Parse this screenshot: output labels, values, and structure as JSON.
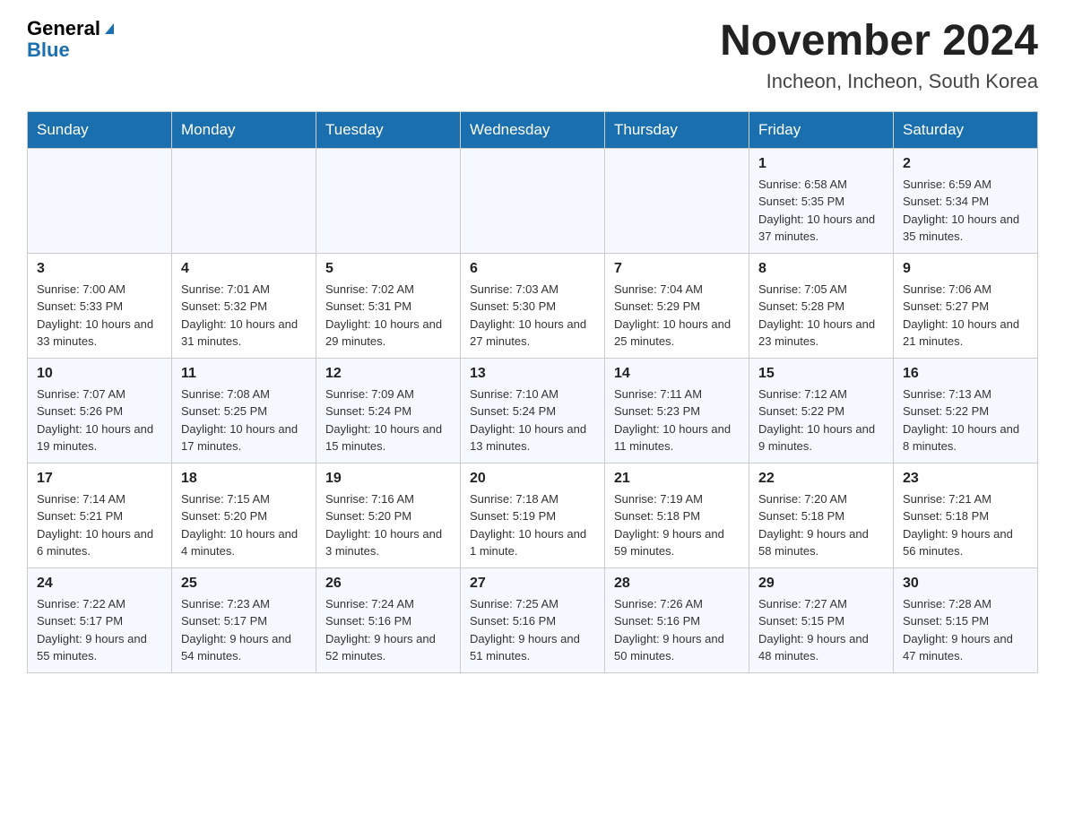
{
  "header": {
    "logo_general": "General",
    "logo_blue": "Blue",
    "title": "November 2024",
    "subtitle": "Incheon, Incheon, South Korea"
  },
  "days_of_week": [
    "Sunday",
    "Monday",
    "Tuesday",
    "Wednesday",
    "Thursday",
    "Friday",
    "Saturday"
  ],
  "weeks": [
    [
      {
        "day": "",
        "info": ""
      },
      {
        "day": "",
        "info": ""
      },
      {
        "day": "",
        "info": ""
      },
      {
        "day": "",
        "info": ""
      },
      {
        "day": "",
        "info": ""
      },
      {
        "day": "1",
        "info": "Sunrise: 6:58 AM\nSunset: 5:35 PM\nDaylight: 10 hours and 37 minutes."
      },
      {
        "day": "2",
        "info": "Sunrise: 6:59 AM\nSunset: 5:34 PM\nDaylight: 10 hours and 35 minutes."
      }
    ],
    [
      {
        "day": "3",
        "info": "Sunrise: 7:00 AM\nSunset: 5:33 PM\nDaylight: 10 hours and 33 minutes."
      },
      {
        "day": "4",
        "info": "Sunrise: 7:01 AM\nSunset: 5:32 PM\nDaylight: 10 hours and 31 minutes."
      },
      {
        "day": "5",
        "info": "Sunrise: 7:02 AM\nSunset: 5:31 PM\nDaylight: 10 hours and 29 minutes."
      },
      {
        "day": "6",
        "info": "Sunrise: 7:03 AM\nSunset: 5:30 PM\nDaylight: 10 hours and 27 minutes."
      },
      {
        "day": "7",
        "info": "Sunrise: 7:04 AM\nSunset: 5:29 PM\nDaylight: 10 hours and 25 minutes."
      },
      {
        "day": "8",
        "info": "Sunrise: 7:05 AM\nSunset: 5:28 PM\nDaylight: 10 hours and 23 minutes."
      },
      {
        "day": "9",
        "info": "Sunrise: 7:06 AM\nSunset: 5:27 PM\nDaylight: 10 hours and 21 minutes."
      }
    ],
    [
      {
        "day": "10",
        "info": "Sunrise: 7:07 AM\nSunset: 5:26 PM\nDaylight: 10 hours and 19 minutes."
      },
      {
        "day": "11",
        "info": "Sunrise: 7:08 AM\nSunset: 5:25 PM\nDaylight: 10 hours and 17 minutes."
      },
      {
        "day": "12",
        "info": "Sunrise: 7:09 AM\nSunset: 5:24 PM\nDaylight: 10 hours and 15 minutes."
      },
      {
        "day": "13",
        "info": "Sunrise: 7:10 AM\nSunset: 5:24 PM\nDaylight: 10 hours and 13 minutes."
      },
      {
        "day": "14",
        "info": "Sunrise: 7:11 AM\nSunset: 5:23 PM\nDaylight: 10 hours and 11 minutes."
      },
      {
        "day": "15",
        "info": "Sunrise: 7:12 AM\nSunset: 5:22 PM\nDaylight: 10 hours and 9 minutes."
      },
      {
        "day": "16",
        "info": "Sunrise: 7:13 AM\nSunset: 5:22 PM\nDaylight: 10 hours and 8 minutes."
      }
    ],
    [
      {
        "day": "17",
        "info": "Sunrise: 7:14 AM\nSunset: 5:21 PM\nDaylight: 10 hours and 6 minutes."
      },
      {
        "day": "18",
        "info": "Sunrise: 7:15 AM\nSunset: 5:20 PM\nDaylight: 10 hours and 4 minutes."
      },
      {
        "day": "19",
        "info": "Sunrise: 7:16 AM\nSunset: 5:20 PM\nDaylight: 10 hours and 3 minutes."
      },
      {
        "day": "20",
        "info": "Sunrise: 7:18 AM\nSunset: 5:19 PM\nDaylight: 10 hours and 1 minute."
      },
      {
        "day": "21",
        "info": "Sunrise: 7:19 AM\nSunset: 5:18 PM\nDaylight: 9 hours and 59 minutes."
      },
      {
        "day": "22",
        "info": "Sunrise: 7:20 AM\nSunset: 5:18 PM\nDaylight: 9 hours and 58 minutes."
      },
      {
        "day": "23",
        "info": "Sunrise: 7:21 AM\nSunset: 5:18 PM\nDaylight: 9 hours and 56 minutes."
      }
    ],
    [
      {
        "day": "24",
        "info": "Sunrise: 7:22 AM\nSunset: 5:17 PM\nDaylight: 9 hours and 55 minutes."
      },
      {
        "day": "25",
        "info": "Sunrise: 7:23 AM\nSunset: 5:17 PM\nDaylight: 9 hours and 54 minutes."
      },
      {
        "day": "26",
        "info": "Sunrise: 7:24 AM\nSunset: 5:16 PM\nDaylight: 9 hours and 52 minutes."
      },
      {
        "day": "27",
        "info": "Sunrise: 7:25 AM\nSunset: 5:16 PM\nDaylight: 9 hours and 51 minutes."
      },
      {
        "day": "28",
        "info": "Sunrise: 7:26 AM\nSunset: 5:16 PM\nDaylight: 9 hours and 50 minutes."
      },
      {
        "day": "29",
        "info": "Sunrise: 7:27 AM\nSunset: 5:15 PM\nDaylight: 9 hours and 48 minutes."
      },
      {
        "day": "30",
        "info": "Sunrise: 7:28 AM\nSunset: 5:15 PM\nDaylight: 9 hours and 47 minutes."
      }
    ]
  ]
}
